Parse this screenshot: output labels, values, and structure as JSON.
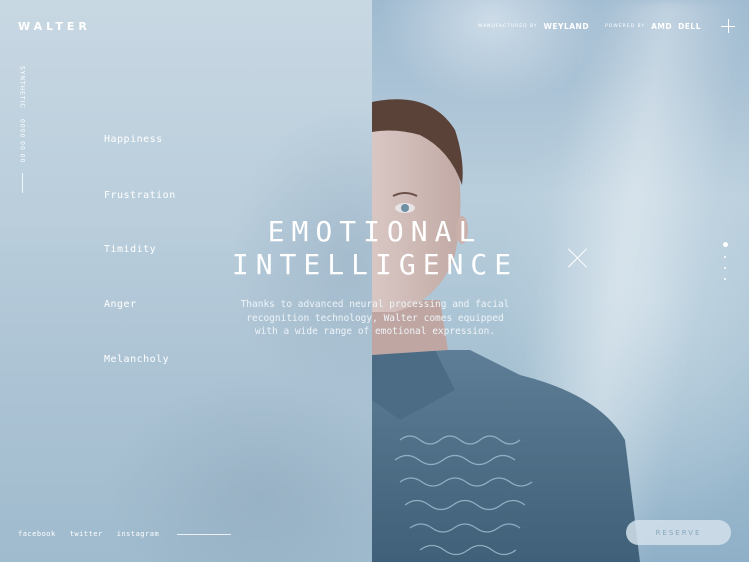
{
  "brand": "WALTER",
  "sidebar": {
    "vertical_text_1": "SYNTHETIC",
    "vertical_text_2": "0000 00 00"
  },
  "topbar": {
    "manufactured_label": "MANUFACTURED BY",
    "manufacturer": "WEYLAND",
    "powered_label": "POWERED BY",
    "partner_1": "AMD",
    "partner_2": "DELL"
  },
  "emotions": [
    "Happiness",
    "Frustration",
    "Timidity",
    "Anger",
    "Melancholy"
  ],
  "hero": {
    "title_line_1": "EMOTIONAL",
    "title_line_2": "INTELLIGENCE",
    "description_line_1": "Thanks to advanced neural processing and facial",
    "description_line_2": "recognition technology, Walter comes equipped",
    "description_line_3": "with a wide range of emotional expression."
  },
  "social": [
    "facebook",
    "twitter",
    "instagram"
  ],
  "reserve_label": "RESERVE",
  "pager": {
    "count": 4,
    "active_index": 0
  },
  "colors": {
    "accent": "#ffffff",
    "bg_blue": "#a9c3d3",
    "button_text": "#8aa7bc"
  },
  "icons": {
    "close": "close-icon",
    "menu": "plus-icon"
  }
}
